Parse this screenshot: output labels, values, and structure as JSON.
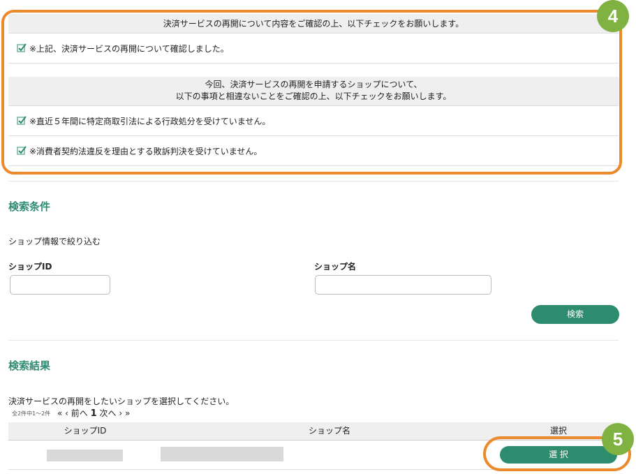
{
  "confirm_section": {
    "header1": "決済サービスの再開について内容をご確認の上、以下チェックをお願いします。",
    "check1": "※上記、決済サービスの再開について確認しました。",
    "header2_line1": "今回、決済サービスの再開を申請するショップについて、",
    "header2_line2": "以下の事項と相違ないことをご確認の上、以下チェックをお願いします。",
    "check2": "※直近５年間に特定商取引法による行政処分を受けていません。",
    "check3": "※消費者契約法違反を理由とする敗訴判決を受けていません。"
  },
  "badges": {
    "badge4": "4",
    "badge5": "5"
  },
  "search": {
    "title": "検索条件",
    "filter_label": "ショップ情報で絞り込む",
    "shop_id_label": "ショップID",
    "shop_id_value": "",
    "shop_name_label": "ショップ名",
    "shop_name_value": "",
    "search_button": "検索"
  },
  "results": {
    "title": "検索結果",
    "instruction": "決済サービスの再開をしたいショップを選択してください。",
    "count_text": "全2件中1～2件",
    "pager_first": "«",
    "pager_prev": "‹ 前へ",
    "pager_current": "1",
    "pager_next": "次へ ›",
    "pager_last": "»",
    "columns": [
      "ショップID",
      "ショップ名",
      "選択"
    ],
    "select_button": "選 択"
  },
  "colors": {
    "accent": "#2d8c6e",
    "highlight": "#ec8a2b",
    "badge": "#7fb241",
    "title": "#2f8c72"
  },
  "icons": {
    "checkbox": "checked-checkbox-icon"
  }
}
